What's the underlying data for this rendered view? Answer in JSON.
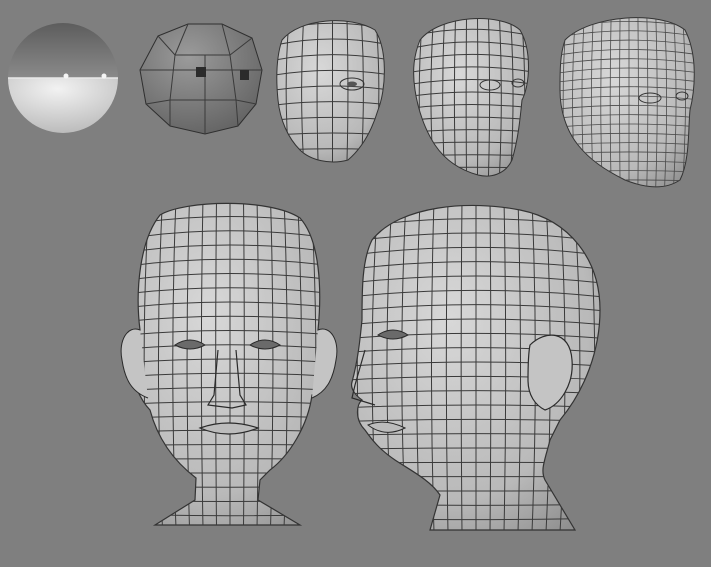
{
  "scene": {
    "background_color": "#808080",
    "mesh_color": "#c9c9c9",
    "wire_color": "#3a3a3a"
  },
  "stages": [
    {
      "name": "uv-sphere-stage"
    },
    {
      "name": "cube-sphere-stage"
    },
    {
      "name": "blockout-head-stage"
    },
    {
      "name": "refined-head-stage"
    },
    {
      "name": "detailed-head-stage"
    }
  ],
  "final_views": [
    {
      "name": "front-view"
    },
    {
      "name": "three-quarter-view"
    }
  ]
}
